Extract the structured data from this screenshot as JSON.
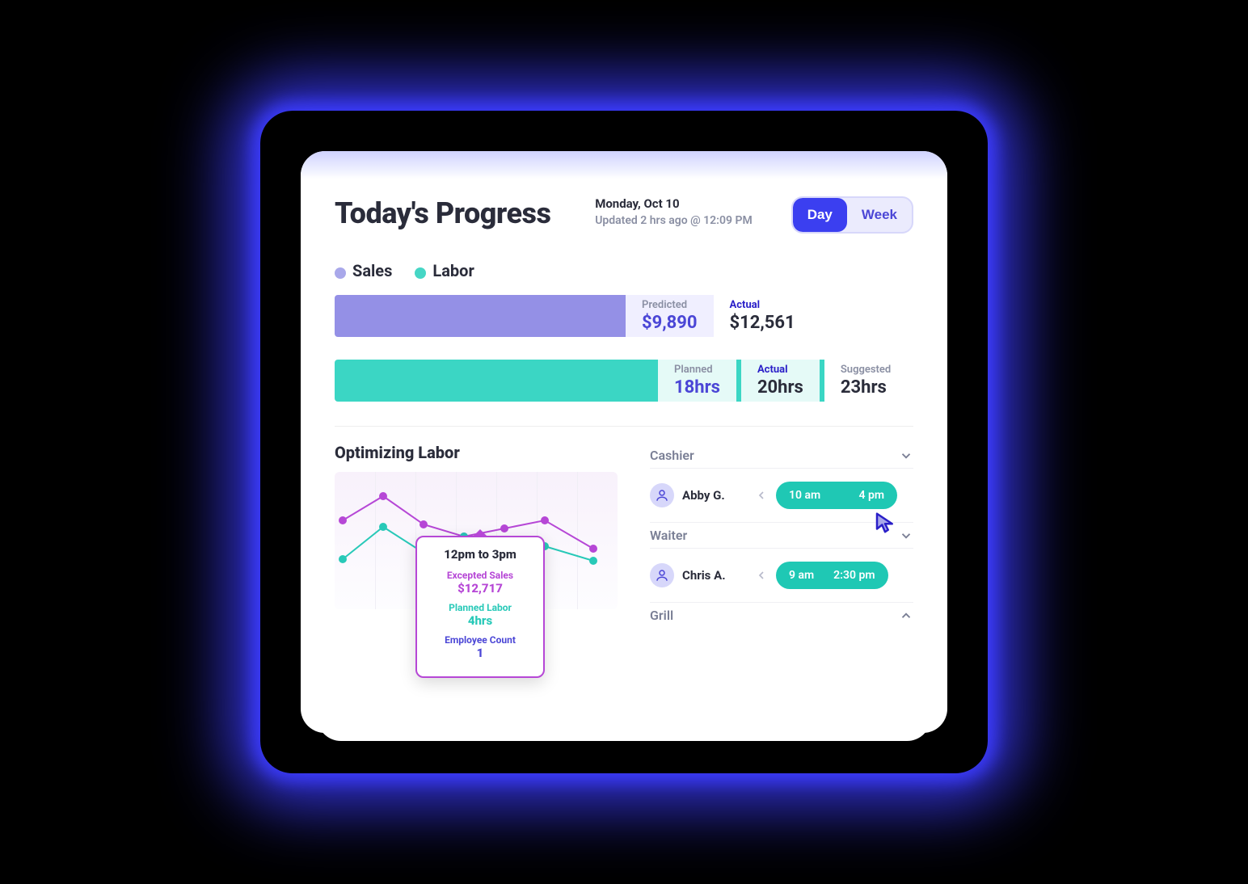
{
  "header": {
    "title": "Today's Progress",
    "date": "Monday, Oct 10",
    "updated": "Updated 2 hrs ago @ 12:09 PM",
    "toggle": {
      "day": "Day",
      "week": "Week"
    }
  },
  "legend": {
    "sales": "Sales",
    "labor": "Labor"
  },
  "sales_bar": {
    "predicted_label": "Predicted",
    "predicted_value": "$9,890",
    "actual_label": "Actual",
    "actual_value": "$12,561"
  },
  "labor_bar": {
    "planned_label": "Planned",
    "planned_value": "18hrs",
    "actual_label": "Actual",
    "actual_value": "20hrs",
    "suggested_label": "Suggested",
    "suggested_value": "23hrs"
  },
  "optimizing": {
    "title": "Optimizing Labor",
    "tooltip": {
      "heading": "12pm to 3pm",
      "sales_label": "Excepted Sales",
      "sales_value": "$12,717",
      "labor_label": "Planned Labor",
      "labor_value": "4hrs",
      "emp_label": "Employee Count",
      "emp_value": "1"
    }
  },
  "roles": {
    "r0": {
      "name": "Cashier",
      "emp": "Abby G.",
      "start": "10 am",
      "end": "4 pm"
    },
    "r1": {
      "name": "Waiter",
      "emp": "Chris A.",
      "start": "9 am",
      "end": "2:30 pm"
    },
    "r2": {
      "name": "Grill"
    }
  },
  "chart_data": {
    "type": "line",
    "x": [
      0,
      1,
      2,
      3,
      4,
      5,
      6
    ],
    "series": [
      {
        "name": "Sales",
        "color": "#b647d6",
        "values": [
          60,
          30,
          65,
          80,
          70,
          60,
          95
        ]
      },
      {
        "name": "Labor",
        "color": "#28c9b8",
        "values": [
          108,
          68,
          100,
          80,
          90,
          92,
          110
        ]
      }
    ],
    "xlim": [
      0,
      6
    ],
    "ylim": [
      0,
      140
    ],
    "y_axis_inverted": true
  },
  "colors": {
    "purple": "#9490e6",
    "teal": "#3bd6c4",
    "accent": "#3b3ff0"
  }
}
